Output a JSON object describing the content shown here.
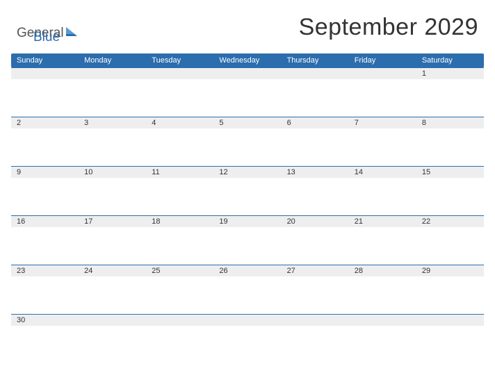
{
  "logo": {
    "text_part1": "General",
    "text_part2": "Blue"
  },
  "title": "September 2029",
  "day_headers": [
    "Sunday",
    "Monday",
    "Tuesday",
    "Wednesday",
    "Thursday",
    "Friday",
    "Saturday"
  ],
  "weeks": [
    [
      "",
      "",
      "",
      "",
      "",
      "",
      "1"
    ],
    [
      "2",
      "3",
      "4",
      "5",
      "6",
      "7",
      "8"
    ],
    [
      "9",
      "10",
      "11",
      "12",
      "13",
      "14",
      "15"
    ],
    [
      "16",
      "17",
      "18",
      "19",
      "20",
      "21",
      "22"
    ],
    [
      "23",
      "24",
      "25",
      "26",
      "27",
      "28",
      "29"
    ],
    [
      "30",
      "",
      "",
      "",
      "",
      "",
      ""
    ]
  ]
}
